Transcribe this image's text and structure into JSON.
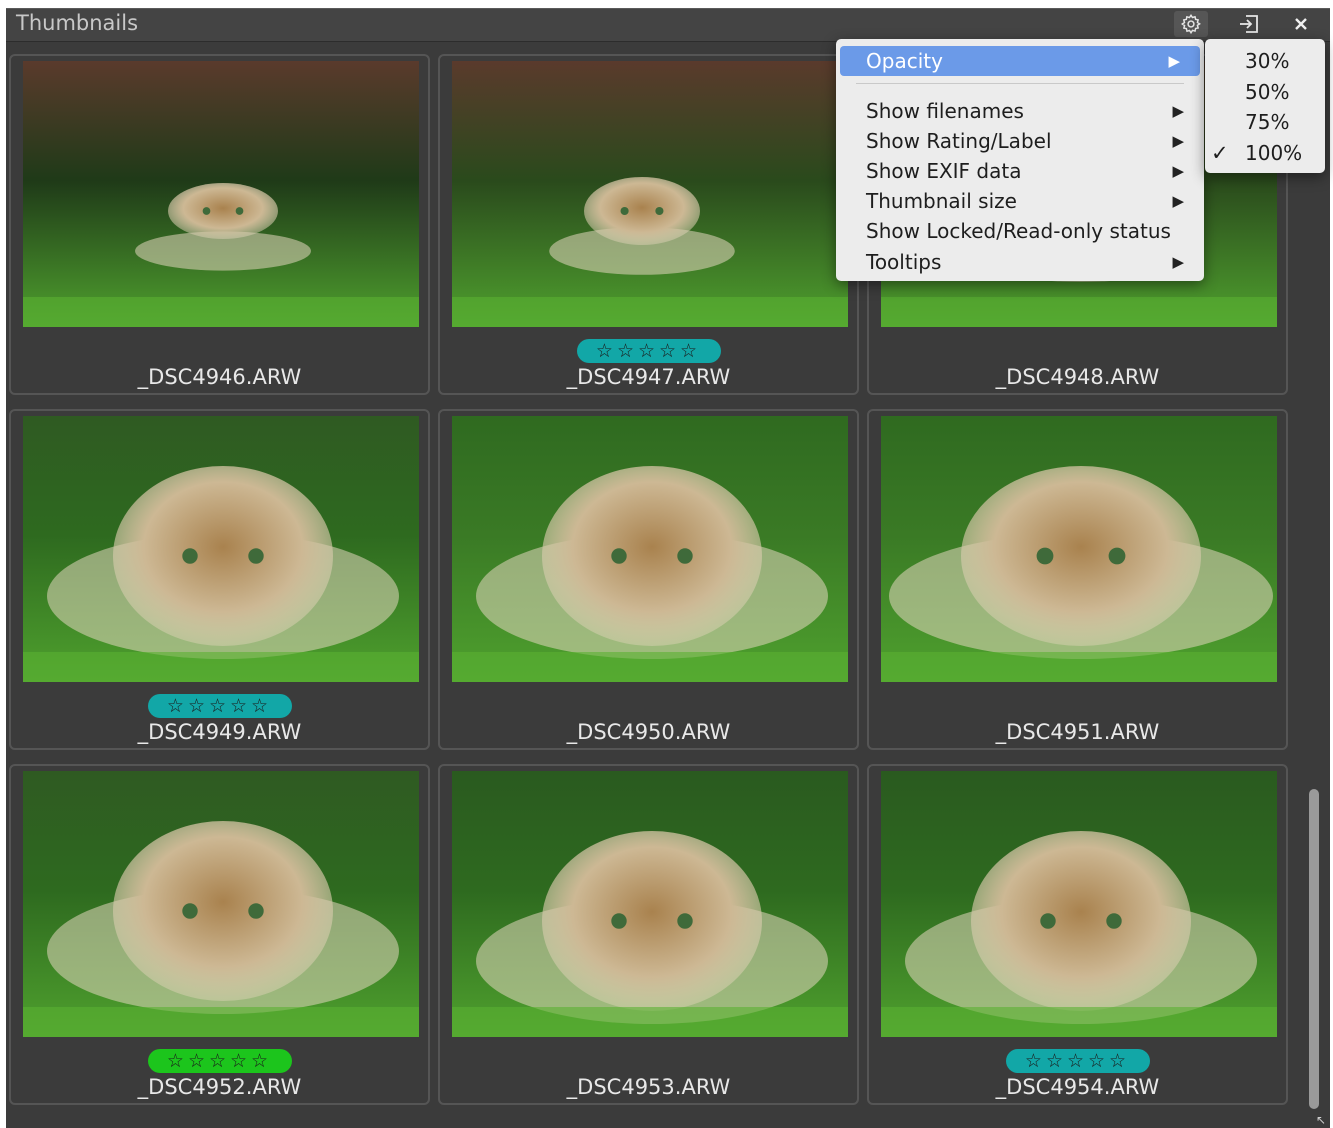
{
  "panel": {
    "title": "Thumbnails",
    "buttons": {
      "settings": "settings-gear-icon",
      "dock": "dock-out-icon",
      "close": "close-icon"
    }
  },
  "thumbnails": [
    {
      "filename": "_DSC4946.ARW",
      "rating": null
    },
    {
      "filename": "_DSC4947.ARW",
      "rating": {
        "stars": "☆☆☆☆☆",
        "label_color": "#12a7a7"
      }
    },
    {
      "filename": "_DSC4948.ARW",
      "rating": null
    },
    {
      "filename": "_DSC4949.ARW",
      "rating": {
        "stars": "☆☆☆☆☆",
        "label_color": "#12a7a7"
      }
    },
    {
      "filename": "_DSC4950.ARW",
      "rating": null
    },
    {
      "filename": "_DSC4951.ARW",
      "rating": null
    },
    {
      "filename": "_DSC4952.ARW",
      "rating": {
        "stars": "☆☆☆☆☆",
        "label_color": "#1cc51c"
      }
    },
    {
      "filename": "_DSC4953.ARW",
      "rating": null
    },
    {
      "filename": "_DSC4954.ARW",
      "rating": {
        "stars": "☆☆☆☆☆",
        "label_color": "#12a7a7"
      }
    }
  ],
  "context_menu": {
    "items": [
      {
        "label": "Opacity",
        "submenu": true,
        "active": true
      },
      {
        "label": "Show filenames",
        "submenu": true
      },
      {
        "label": "Show Rating/Label",
        "submenu": true
      },
      {
        "label": "Show EXIF data",
        "submenu": true
      },
      {
        "label": "Thumbnail size",
        "submenu": true
      },
      {
        "label": "Show Locked/Read-only status",
        "submenu": false
      },
      {
        "label": "Tooltips",
        "submenu": true
      }
    ],
    "arrow": "▶"
  },
  "opacity_submenu": {
    "options": [
      {
        "label": "30%",
        "checked": false
      },
      {
        "label": "50%",
        "checked": false
      },
      {
        "label": "75%",
        "checked": false
      },
      {
        "label": "100%",
        "checked": true
      }
    ],
    "check_mark": "✓"
  },
  "colors": {
    "panel_bg": "#3b3b3b",
    "menu_highlight": "#6b9ae8",
    "label_teal": "#12a7a7",
    "label_green": "#1cc51c"
  }
}
